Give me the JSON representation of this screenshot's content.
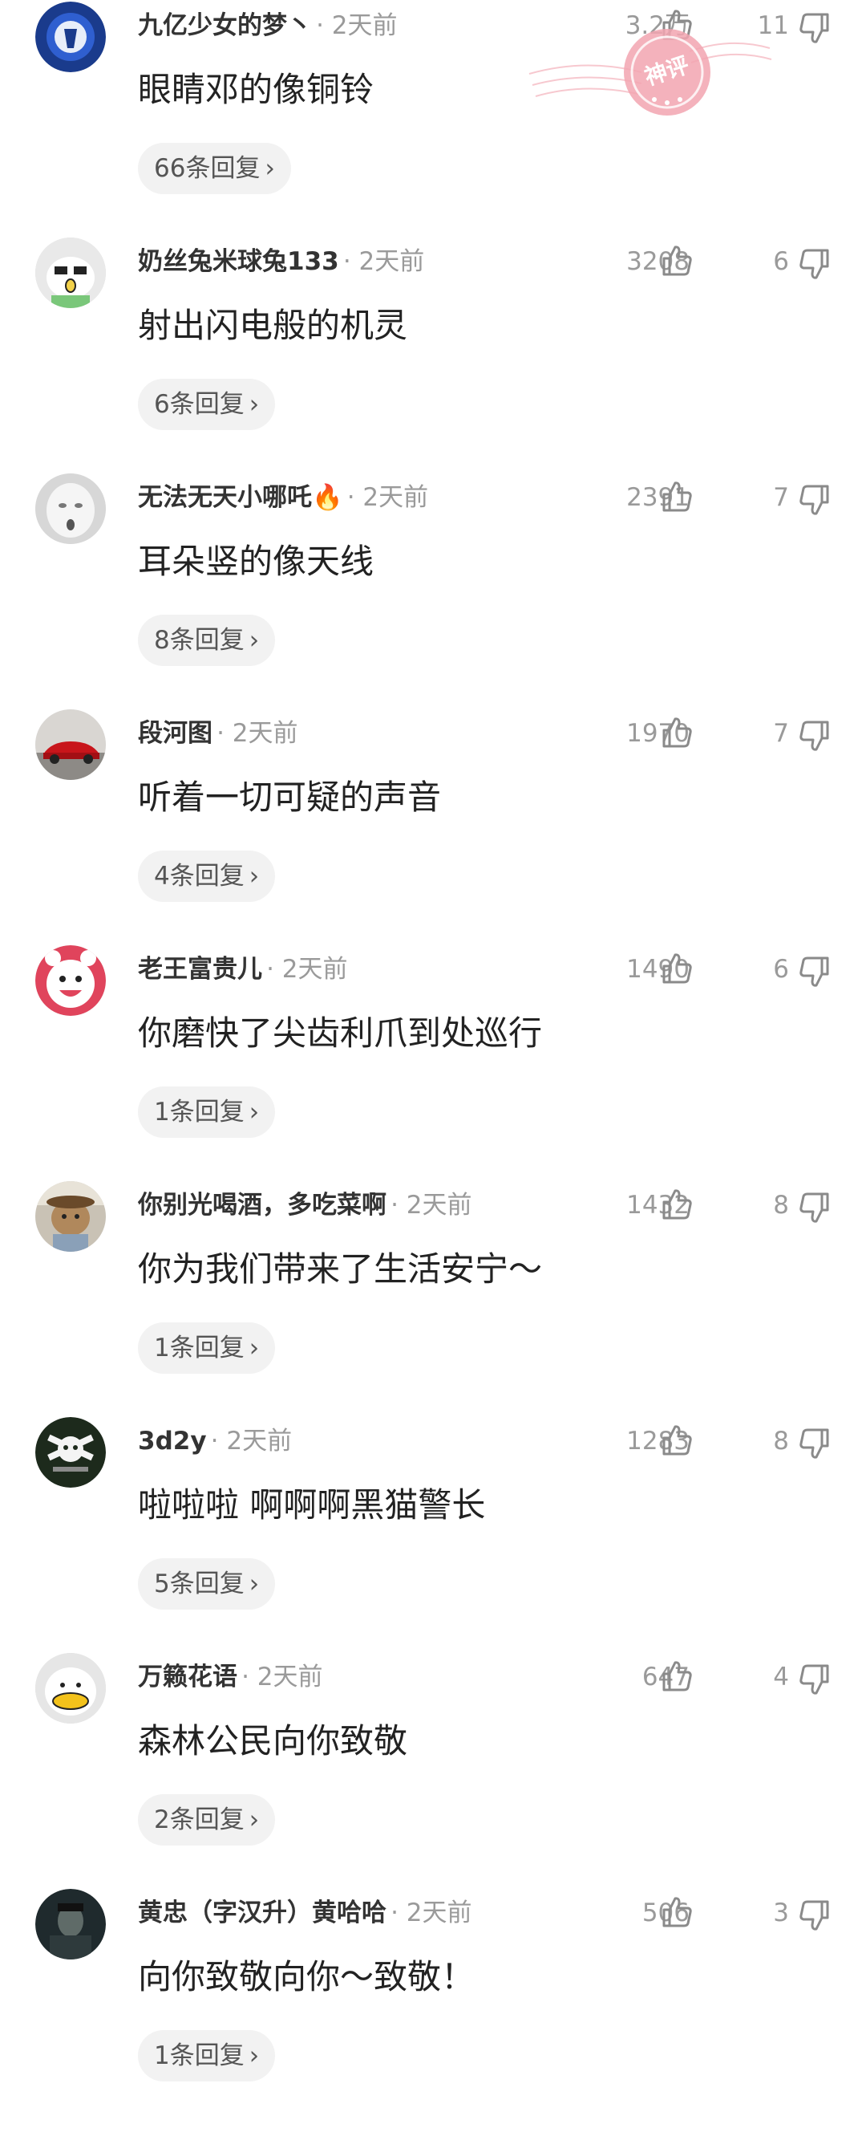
{
  "badge_text": "神评",
  "colors": {
    "accent_red": "#f2a5b0",
    "muted": "#9a9a9a"
  },
  "comments": [
    {
      "name": "九亿少女的梦丶",
      "time": "· 2天前",
      "likes": "3.2万",
      "dislikes": "11",
      "text": "眼睛邓的像铜铃",
      "replies": "66条回复",
      "avatar": "team-logo"
    },
    {
      "name": "奶丝兔米球兔133",
      "time": "· 2天前",
      "likes": "3208",
      "dislikes": "6",
      "text": "射出闪电般的机灵",
      "replies": "6条回复",
      "avatar": "cartoon-face"
    },
    {
      "name": "无法无天小哪吒🔥",
      "time": "· 2天前",
      "likes": "2391",
      "dislikes": "7",
      "text": "耳朵竖的像天线",
      "replies": "8条回复",
      "avatar": "white-face"
    },
    {
      "name": "段河图",
      "time": "· 2天前",
      "likes": "1970",
      "dislikes": "7",
      "text": "听着一切可疑的声音",
      "replies": "4条回复",
      "avatar": "red-car"
    },
    {
      "name": "老王富贵儿",
      "time": "· 2天前",
      "likes": "1490",
      "dislikes": "6",
      "text": "你磨快了尖齿利爪到处巡行",
      "replies": "1条回复",
      "avatar": "red-cartoon"
    },
    {
      "name": "你别光喝酒，多吃菜啊",
      "time": "· 2天前",
      "likes": "1432",
      "dislikes": "8",
      "text": "你为我们带来了生活安宁～",
      "replies": "1条回复",
      "avatar": "dog-photo"
    },
    {
      "name": "3d2y",
      "time": "· 2天前",
      "likes": "1283",
      "dislikes": "8",
      "text": "啦啦啦 啊啊啊黑猫警长",
      "replies": "5条回复",
      "avatar": "dark-logo"
    },
    {
      "name": "万籁花语",
      "time": "· 2天前",
      "likes": "647",
      "dislikes": "4",
      "text": "森林公民向你致敬",
      "replies": "2条回复",
      "avatar": "duck-face"
    },
    {
      "name": "黄忠（字汉升）黄哈哈",
      "time": "· 2天前",
      "likes": "506",
      "dislikes": "3",
      "text": "向你致敬向你～致敬！",
      "replies": "1条回复",
      "avatar": "dark-portrait"
    }
  ]
}
